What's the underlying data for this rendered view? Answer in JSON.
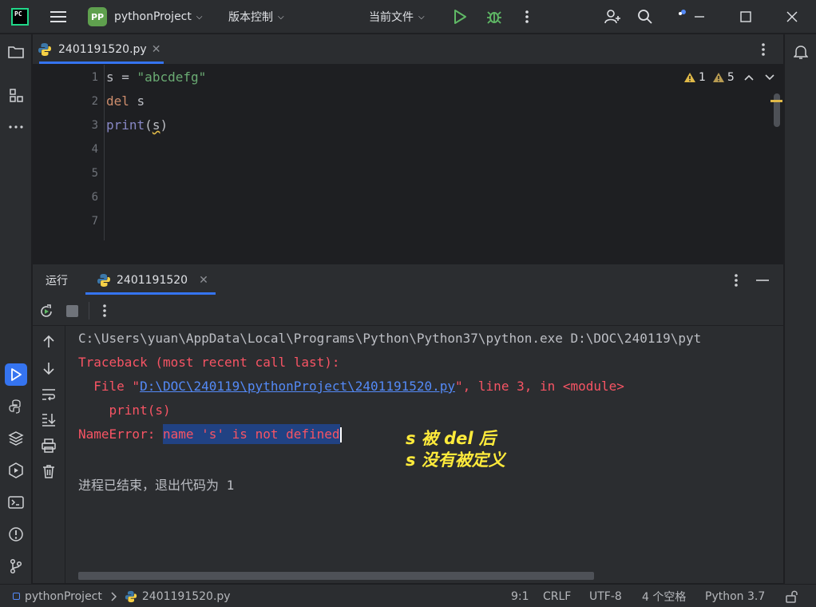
{
  "titlebar": {
    "project_badge": "PP",
    "project_name": "pythonProject",
    "vcs_menu": "版本控制",
    "run_config": "当前文件"
  },
  "editor": {
    "tab_name": "2401191520.py",
    "warnings_1": "1",
    "warnings_2": "5",
    "line_numbers": [
      "1",
      "2",
      "3",
      "4",
      "5",
      "6",
      "7"
    ],
    "code": {
      "line1_var": "s",
      "line1_op": " = ",
      "line1_str": "\"abcdefg\"",
      "line2_kw": "del",
      "line2_rest": " s",
      "line3_fn": "print",
      "line3_open": "(",
      "line3_arg": "s",
      "line3_close": ")"
    }
  },
  "run_panel": {
    "tab_run": "运行",
    "tab_config": "2401191520",
    "console": {
      "cmd": "C:\\Users\\yuan\\AppData\\Local\\Programs\\Python\\Python37\\python.exe D:\\DOC\\240119\\pyt",
      "traceback": "Traceback (most recent call last):",
      "file_prefix": "  File \"",
      "file_link": "D:\\DOC\\240119\\pythonProject\\2401191520.py",
      "file_suffix": "\", line 3, in <module>",
      "code_line": "    print(s)",
      "error_prefix": "NameError: ",
      "error_msg": "name 's' is not defined",
      "exit": "进程已结束，退出代码为 1"
    },
    "annotation_line1": "s 被 del 后",
    "annotation_line2": "s 没有被定义"
  },
  "statusbar": {
    "project": "pythonProject",
    "file": "2401191520.py",
    "position": "9:1",
    "line_sep": "CRLF",
    "encoding": "UTF-8",
    "indent": "4 个空格",
    "interpreter": "Python 3.7"
  },
  "colors": {
    "background": "#1e1f22",
    "panel": "#2b2d30",
    "keyword": "#cf8e6d",
    "string": "#6aab73",
    "function": "#56a8f5",
    "error_text": "#f75464",
    "link": "#548af7",
    "selection": "#214283",
    "annotation": "#ffeb3b",
    "run_green": "#5fb865",
    "active_accent": "#3574f0"
  }
}
